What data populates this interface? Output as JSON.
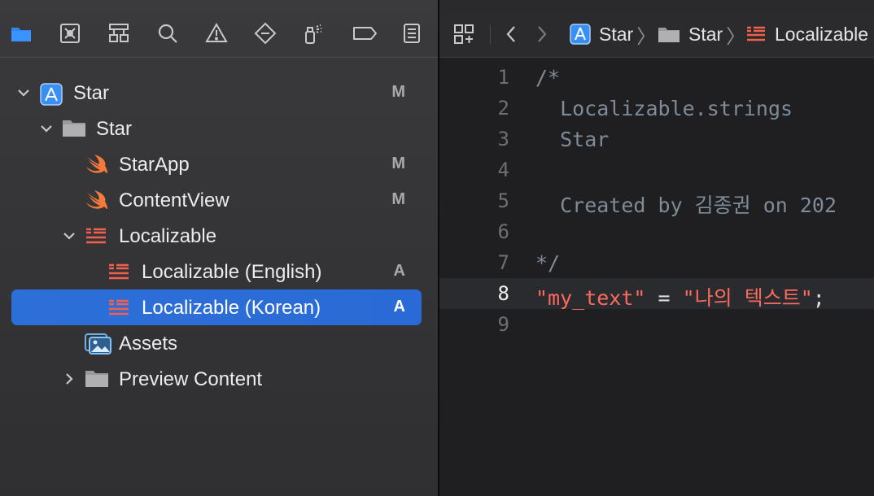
{
  "navigator": {
    "tabs": [
      {
        "name": "project-navigator-folder-icon",
        "active": true
      },
      {
        "name": "source-control-icon"
      },
      {
        "name": "symbol-hierarchy-icon"
      },
      {
        "name": "find-magnifier-icon"
      },
      {
        "name": "issue-warning-icon"
      },
      {
        "name": "test-diamond-icon"
      },
      {
        "name": "debug-spray-icon"
      },
      {
        "name": "breakpoint-tag-icon"
      },
      {
        "name": "report-list-icon"
      }
    ],
    "tree": [
      {
        "label": "Star",
        "badge": "M",
        "icon": "xcode-project-icon",
        "level": 0,
        "disclosure": "expanded"
      },
      {
        "label": "Star",
        "badge": "",
        "icon": "folder-icon",
        "level": 1,
        "disclosure": "expanded"
      },
      {
        "label": "StarApp",
        "badge": "M",
        "icon": "swift-icon",
        "level": 2,
        "disclosure": ""
      },
      {
        "label": "ContentView",
        "badge": "M",
        "icon": "swift-icon",
        "level": 2,
        "disclosure": ""
      },
      {
        "label": "Localizable",
        "badge": "",
        "icon": "strings-file-icon",
        "level": 2,
        "disclosure": "expanded"
      },
      {
        "label": "Localizable (English)",
        "badge": "A",
        "icon": "strings-file-icon",
        "level": 3,
        "disclosure": ""
      },
      {
        "label": "Localizable (Korean)",
        "badge": "A",
        "icon": "strings-file-icon",
        "level": 3,
        "disclosure": "",
        "selected": true
      },
      {
        "label": "Assets",
        "badge": "",
        "icon": "asset-catalog-icon",
        "level": 2,
        "disclosure": ""
      },
      {
        "label": "Preview Content",
        "badge": "",
        "icon": "folder-icon",
        "level": 2,
        "disclosure": "collapsed"
      }
    ]
  },
  "jumpbar": {
    "crumbs": [
      "Star",
      "Star",
      "Localizable"
    ]
  },
  "editor": {
    "current_line": 8,
    "lines": [
      {
        "no": "1",
        "text": "/*"
      },
      {
        "no": "2",
        "text": "  Localizable.strings"
      },
      {
        "no": "3",
        "text": "  Star"
      },
      {
        "no": "4",
        "text": ""
      },
      {
        "no": "5",
        "text": "  Created by 김종권 on 202"
      },
      {
        "no": "6",
        "text": ""
      },
      {
        "no": "7",
        "text": "*/"
      },
      {
        "no": "8",
        "key": "\"my_text\"",
        "op": " = ",
        "value": "\"나의 텍스트\"",
        "end": ";"
      },
      {
        "no": "9",
        "text": ""
      }
    ]
  },
  "colors": {
    "selection": "#2d6fd9",
    "string": "#fc6a5d",
    "comment": "#7f8c98",
    "accent_blue": "#2f86f6"
  }
}
